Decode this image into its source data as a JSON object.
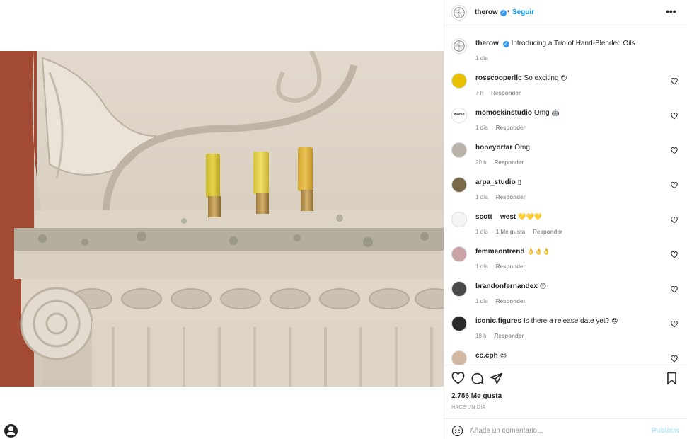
{
  "post": {
    "account": "therow",
    "follow_label": "Seguir",
    "header_separator": "•",
    "more_label": "•••",
    "caption": "Introducing a Trio of Hand-Blended Oils",
    "caption_time": "1 día"
  },
  "comments": [
    {
      "user": "rosscooperllc",
      "text": "So exciting",
      "emoji": "😍",
      "time": "7 h",
      "likes": "",
      "reply": "Responder",
      "avatar_color": "#e8c200"
    },
    {
      "user": "momoskinstudio",
      "text": "Omg",
      "emoji": "🤖",
      "time": "1 día",
      "likes": "",
      "reply": "Responder",
      "avatar_color": "#ffffff",
      "avatar_text": "momo"
    },
    {
      "user": "honeyortar",
      "text": "Omg",
      "emoji": "",
      "time": "20 h",
      "likes": "",
      "reply": "Responder",
      "avatar_color": "#b9b2a8"
    },
    {
      "user": "arpa_studio",
      "text": "",
      "emoji": "▯",
      "time": "1 día",
      "likes": "",
      "reply": "Responder",
      "avatar_color": "#7a6a4a"
    },
    {
      "user": "scott__west",
      "text": "",
      "emoji": "💛💛💛",
      "time": "1 día",
      "likes": "1 Me gusta",
      "reply": "Responder",
      "avatar_color": "#f4f4f4"
    },
    {
      "user": "femmeontrend",
      "text": "",
      "emoji": "👌👌👌",
      "time": "1 día",
      "likes": "",
      "reply": "Responder",
      "avatar_color": "#c9a3a8"
    },
    {
      "user": "brandonfernandex",
      "text": "",
      "emoji": "😍",
      "time": "1 día",
      "likes": "",
      "reply": "Responder",
      "avatar_color": "#4a4a4a"
    },
    {
      "user": "iconic.figures",
      "text": "Is there a release date yet?",
      "emoji": "😍",
      "time": "18 h",
      "likes": "",
      "reply": "Responder",
      "avatar_color": "#2a2a2a"
    },
    {
      "user": "cc.cph",
      "text": "",
      "emoji": "😍",
      "time": "",
      "likes": "",
      "reply": "",
      "avatar_color": "#d2b7a2"
    }
  ],
  "engagement": {
    "likes": "2.786 Me gusta",
    "posted": "HACE UN DÍA"
  },
  "composer": {
    "placeholder": "Añade un comentario...",
    "publish_label": "Publicar"
  },
  "colors": {
    "accent": "#0095f6",
    "verified": "#3897f0",
    "muted": "#8e8e8e"
  }
}
